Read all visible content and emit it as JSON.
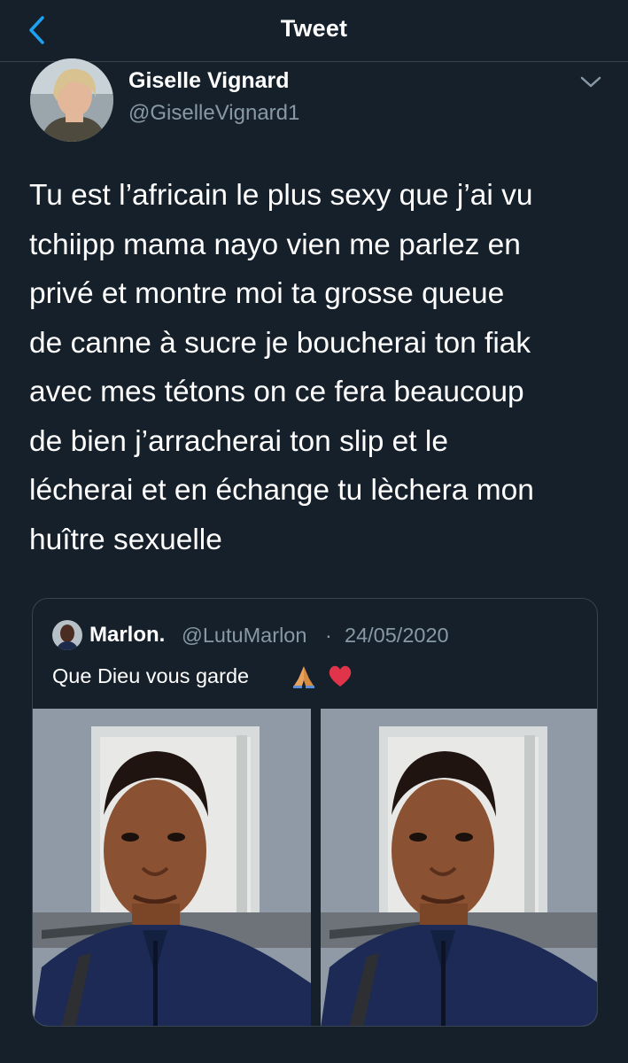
{
  "header": {
    "title": "Tweet",
    "back_icon": "chevron-left-icon",
    "accent": "#1da1f2"
  },
  "tweet": {
    "author_name": "Giselle Vignard",
    "author_handle": "@GiselleVignard1",
    "more_icon": "chevron-down-icon",
    "text": "Tu est l’africain le plus sexy que j’ai vu\ntchiipp mama nayo vien me parlez en\nprivé et montre moi ta grosse queue\nde canne à sucre je boucherai ton fiak\navec mes tétons on ce fera beaucoup\nde bien j’arracherai ton slip et le\nlécherai et en échange tu lèchera mon\nhuître sexuelle"
  },
  "quoted": {
    "author_name": "Marlon.",
    "author_handle": "@LutuMarlon",
    "separator": "·",
    "date": "24/05/2020",
    "text": "Que Dieu vous garde",
    "emojis": [
      "folded-hands-icon",
      "red-heart-icon"
    ],
    "photos": [
      "selfie-photo-1",
      "selfie-photo-2"
    ]
  },
  "colors": {
    "background": "#15202b",
    "border": "#38444d",
    "secondary_text": "#8899a6"
  }
}
